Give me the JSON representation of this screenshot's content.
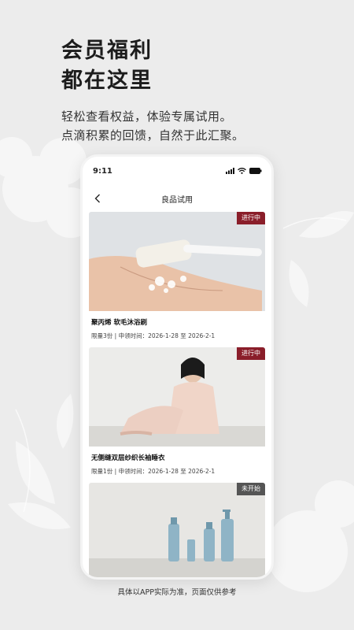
{
  "headline": {
    "line1": "会员福利",
    "line2": "都在这里"
  },
  "subline": {
    "line1": "轻松查看权益，体验专属试用。",
    "line2": "点滴积累的回馈，自然于此汇聚。"
  },
  "phone": {
    "status_time": "9:11",
    "nav_title": "良品试用",
    "cards": [
      {
        "title": "聚丙烯 软毛沐浴刷",
        "meta": "限量3份 | 申领时间：2026-1-28 至 2026-2-1",
        "badge": "进行中",
        "badge_color": "#8a1e2a"
      },
      {
        "title": "无侧缝双层纱织长袖睡衣",
        "meta": "限量1份 | 申领时间：2026-1-28 至 2026-2-1",
        "badge": "进行中",
        "badge_color": "#8a1e2a"
      },
      {
        "title": "",
        "meta": "",
        "badge": "未开始",
        "badge_color": "#555555"
      }
    ]
  },
  "footer_note": "具体以APP实际为准，页面仅供参考",
  "icons": [
    "back-chevron-icon",
    "signal-icon",
    "wifi-icon",
    "battery-icon"
  ]
}
